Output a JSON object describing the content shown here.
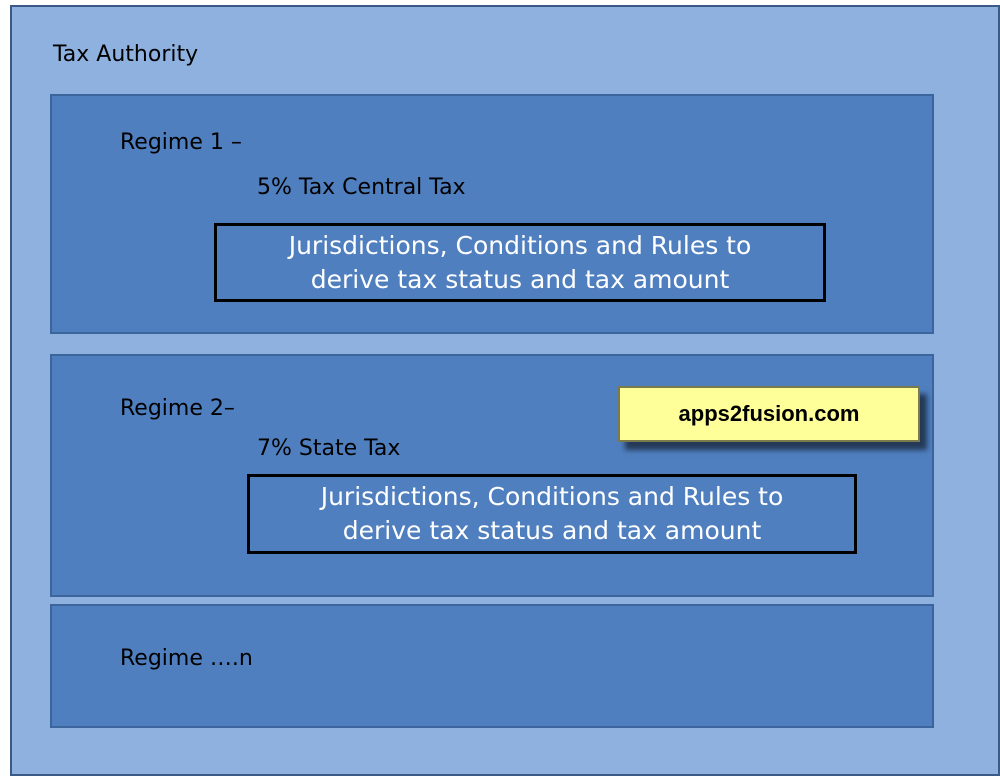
{
  "authority": {
    "title": "Tax Authority"
  },
  "regimes": [
    {
      "title": "Regime 1 –",
      "tax": "5% Tax Central Tax",
      "rules": [
        "Jurisdictions, Conditions and Rules to",
        "derive tax status and tax amount"
      ]
    },
    {
      "title": "Regime 2–",
      "tax": "7% State Tax",
      "rules": [
        "Jurisdictions, Conditions and Rules to",
        "derive tax status and tax amount"
      ]
    },
    {
      "title": "Regime ….n"
    }
  ],
  "watermark": "apps2fusion.com",
  "colors": {
    "outer_fill": "#8eb1e0",
    "regime_fill": "#4f7fbf",
    "callout_fill": "#ffff99"
  }
}
